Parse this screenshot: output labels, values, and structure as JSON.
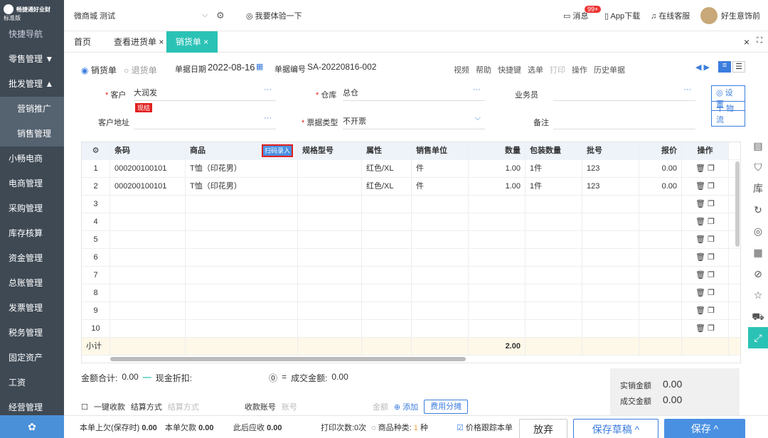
{
  "app": {
    "logo_line1": "畅捷通好业财",
    "logo_line2": "标准版",
    "store": "微商城 测试",
    "try": "我要体验一下",
    "messages": "消息",
    "msg_badge": "99+",
    "app_download": "App下载",
    "online_service": "在线客服",
    "user": "好生意饰前"
  },
  "sidebar": {
    "items": [
      {
        "label": "快捷导航"
      },
      {
        "label": "零售管理 ▼"
      },
      {
        "label": "批发管理 ▲"
      },
      {
        "label": "营销推广"
      },
      {
        "label": "销售管理"
      },
      {
        "label": "小畅电商"
      },
      {
        "label": "电商管理"
      },
      {
        "label": "采购管理"
      },
      {
        "label": "库存核算"
      },
      {
        "label": "资金管理"
      },
      {
        "label": "总账管理"
      },
      {
        "label": "发票管理"
      },
      {
        "label": "税务管理"
      },
      {
        "label": "固定资产"
      },
      {
        "label": "工资"
      },
      {
        "label": "经营管理"
      }
    ]
  },
  "tabs": [
    {
      "label": "首页"
    },
    {
      "label": "查看进货单 ×"
    },
    {
      "label": "销货单 ×"
    }
  ],
  "form": {
    "type_sale": "销货单",
    "type_return": "退货单",
    "date_label": "单据日期",
    "date": "2022-08-16",
    "no_label": "单据编号",
    "no": "SA-20220816-002",
    "toolbar": [
      "视频",
      "帮助",
      "快捷键",
      "选单",
      "打印",
      "操作",
      "历史单据"
    ],
    "customer_label": "客户",
    "customer": "大润发",
    "settle_tag": "现结",
    "warehouse_label": "仓库",
    "warehouse": "总仓",
    "salesman_label": "业务员",
    "setting_btn": "设置",
    "logistics_btn": "十 物流",
    "address_label": "客户地址",
    "invoice_label": "票据类型",
    "invoice": "不开票",
    "remark_label": "备注"
  },
  "grid": {
    "headers": [
      "条码",
      "商品",
      "规格型号",
      "属性",
      "销售单位",
      "数量",
      "包装数量",
      "批号",
      "报价",
      "操作"
    ],
    "scan_btn": "扫码录入",
    "rows": [
      {
        "n": "1",
        "code": "000200100101",
        "name": "T恤（印花男）",
        "attr": "红色/XL",
        "unit": "件",
        "qty": "1.00",
        "pack": "1件",
        "batch": "123",
        "price": "0.00"
      },
      {
        "n": "2",
        "code": "000200100101",
        "name": "T恤（印花男）",
        "attr": "红色/XL",
        "unit": "件",
        "qty": "1.00",
        "pack": "1件",
        "batch": "123",
        "price": "0.00"
      },
      {
        "n": "3"
      },
      {
        "n": "4"
      },
      {
        "n": "5"
      },
      {
        "n": "6"
      },
      {
        "n": "7"
      },
      {
        "n": "8"
      },
      {
        "n": "9"
      },
      {
        "n": "10"
      }
    ],
    "subtotal_label": "小计",
    "subtotal_qty": "2.00"
  },
  "summary": {
    "amount_label": "金额合计:",
    "amount": "0.00",
    "cash_discount_label": "现金折扣:",
    "deal_amount_label": "成交金额:",
    "deal_amount": "0.00",
    "one_key": "一键收款",
    "settle_method_label": "结算方式",
    "settle_method_ph": "结算方式",
    "account_label": "收款账号",
    "account_ph": "账号",
    "money_label": "金额",
    "add": "添加",
    "fee_btn": "费用分摊",
    "actual_label": "实销金额",
    "actual": "0.00",
    "deal_label": "成交金额",
    "deal": "0.00"
  },
  "bottom": {
    "last_debt_label": "本单上欠(保存时)",
    "last_debt": "0.00",
    "debt_label": "本单欠款",
    "debt": "0.00",
    "receivable_label": "此后应收",
    "receivable": "0.00",
    "print_count": "打印次数:0次",
    "kinds_label": "商品种类:",
    "kinds": "1",
    "kinds_unit": "种",
    "track": "价格跟踪本单",
    "discard": "放弃",
    "draft": "保存草稿 ^",
    "save": "保存 ^"
  }
}
